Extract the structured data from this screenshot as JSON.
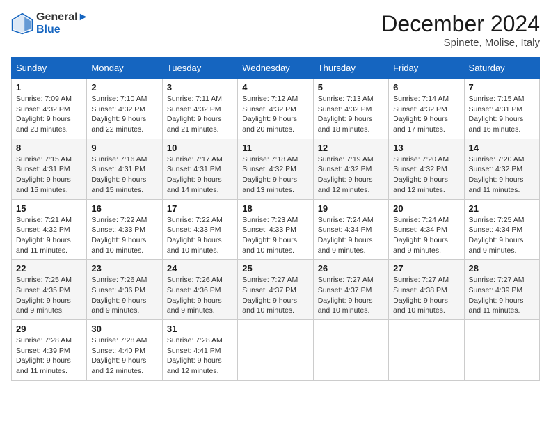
{
  "header": {
    "logo_line1": "General",
    "logo_line2": "Blue",
    "month_title": "December 2024",
    "location": "Spinete, Molise, Italy"
  },
  "weekdays": [
    "Sunday",
    "Monday",
    "Tuesday",
    "Wednesday",
    "Thursday",
    "Friday",
    "Saturday"
  ],
  "weeks": [
    [
      {
        "day": "1",
        "sunrise": "7:09 AM",
        "sunset": "4:32 PM",
        "daylight": "9 hours and 23 minutes."
      },
      {
        "day": "2",
        "sunrise": "7:10 AM",
        "sunset": "4:32 PM",
        "daylight": "9 hours and 22 minutes."
      },
      {
        "day": "3",
        "sunrise": "7:11 AM",
        "sunset": "4:32 PM",
        "daylight": "9 hours and 21 minutes."
      },
      {
        "day": "4",
        "sunrise": "7:12 AM",
        "sunset": "4:32 PM",
        "daylight": "9 hours and 20 minutes."
      },
      {
        "day": "5",
        "sunrise": "7:13 AM",
        "sunset": "4:32 PM",
        "daylight": "9 hours and 18 minutes."
      },
      {
        "day": "6",
        "sunrise": "7:14 AM",
        "sunset": "4:32 PM",
        "daylight": "9 hours and 17 minutes."
      },
      {
        "day": "7",
        "sunrise": "7:15 AM",
        "sunset": "4:31 PM",
        "daylight": "9 hours and 16 minutes."
      }
    ],
    [
      {
        "day": "8",
        "sunrise": "7:15 AM",
        "sunset": "4:31 PM",
        "daylight": "9 hours and 15 minutes."
      },
      {
        "day": "9",
        "sunrise": "7:16 AM",
        "sunset": "4:31 PM",
        "daylight": "9 hours and 15 minutes."
      },
      {
        "day": "10",
        "sunrise": "7:17 AM",
        "sunset": "4:31 PM",
        "daylight": "9 hours and 14 minutes."
      },
      {
        "day": "11",
        "sunrise": "7:18 AM",
        "sunset": "4:32 PM",
        "daylight": "9 hours and 13 minutes."
      },
      {
        "day": "12",
        "sunrise": "7:19 AM",
        "sunset": "4:32 PM",
        "daylight": "9 hours and 12 minutes."
      },
      {
        "day": "13",
        "sunrise": "7:20 AM",
        "sunset": "4:32 PM",
        "daylight": "9 hours and 12 minutes."
      },
      {
        "day": "14",
        "sunrise": "7:20 AM",
        "sunset": "4:32 PM",
        "daylight": "9 hours and 11 minutes."
      }
    ],
    [
      {
        "day": "15",
        "sunrise": "7:21 AM",
        "sunset": "4:32 PM",
        "daylight": "9 hours and 11 minutes."
      },
      {
        "day": "16",
        "sunrise": "7:22 AM",
        "sunset": "4:33 PM",
        "daylight": "9 hours and 10 minutes."
      },
      {
        "day": "17",
        "sunrise": "7:22 AM",
        "sunset": "4:33 PM",
        "daylight": "9 hours and 10 minutes."
      },
      {
        "day": "18",
        "sunrise": "7:23 AM",
        "sunset": "4:33 PM",
        "daylight": "9 hours and 10 minutes."
      },
      {
        "day": "19",
        "sunrise": "7:24 AM",
        "sunset": "4:34 PM",
        "daylight": "9 hours and 9 minutes."
      },
      {
        "day": "20",
        "sunrise": "7:24 AM",
        "sunset": "4:34 PM",
        "daylight": "9 hours and 9 minutes."
      },
      {
        "day": "21",
        "sunrise": "7:25 AM",
        "sunset": "4:34 PM",
        "daylight": "9 hours and 9 minutes."
      }
    ],
    [
      {
        "day": "22",
        "sunrise": "7:25 AM",
        "sunset": "4:35 PM",
        "daylight": "9 hours and 9 minutes."
      },
      {
        "day": "23",
        "sunrise": "7:26 AM",
        "sunset": "4:36 PM",
        "daylight": "9 hours and 9 minutes."
      },
      {
        "day": "24",
        "sunrise": "7:26 AM",
        "sunset": "4:36 PM",
        "daylight": "9 hours and 9 minutes."
      },
      {
        "day": "25",
        "sunrise": "7:27 AM",
        "sunset": "4:37 PM",
        "daylight": "9 hours and 10 minutes."
      },
      {
        "day": "26",
        "sunrise": "7:27 AM",
        "sunset": "4:37 PM",
        "daylight": "9 hours and 10 minutes."
      },
      {
        "day": "27",
        "sunrise": "7:27 AM",
        "sunset": "4:38 PM",
        "daylight": "9 hours and 10 minutes."
      },
      {
        "day": "28",
        "sunrise": "7:27 AM",
        "sunset": "4:39 PM",
        "daylight": "9 hours and 11 minutes."
      }
    ],
    [
      {
        "day": "29",
        "sunrise": "7:28 AM",
        "sunset": "4:39 PM",
        "daylight": "9 hours and 11 minutes."
      },
      {
        "day": "30",
        "sunrise": "7:28 AM",
        "sunset": "4:40 PM",
        "daylight": "9 hours and 12 minutes."
      },
      {
        "day": "31",
        "sunrise": "7:28 AM",
        "sunset": "4:41 PM",
        "daylight": "9 hours and 12 minutes."
      },
      null,
      null,
      null,
      null
    ]
  ],
  "labels": {
    "sunrise": "Sunrise:",
    "sunset": "Sunset:",
    "daylight": "Daylight:"
  }
}
